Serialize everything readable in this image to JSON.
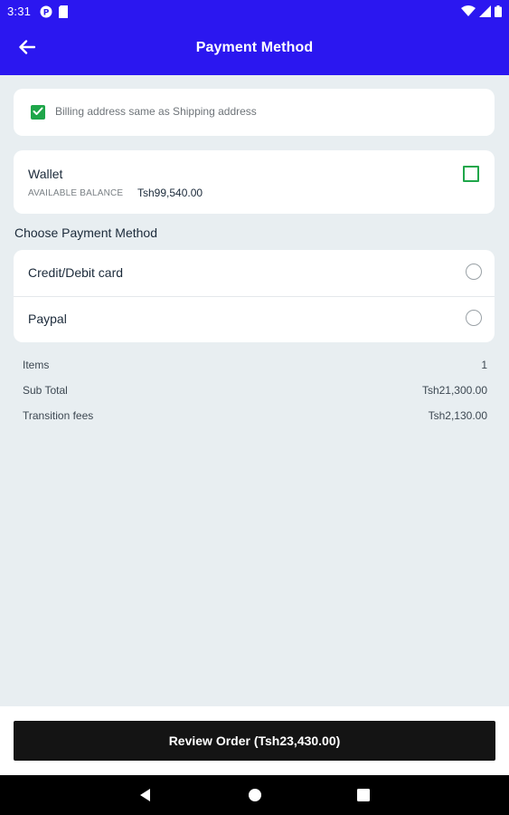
{
  "status_bar": {
    "time": "3:31",
    "icons": [
      "p-badge-icon",
      "sd-card-icon",
      "wifi-icon",
      "signal-icon",
      "battery-icon"
    ]
  },
  "app_bar": {
    "title": "Payment Method",
    "back_icon": "arrow-left-icon"
  },
  "billing": {
    "label": "Billing address same as Shipping address",
    "checked": true
  },
  "wallet": {
    "title": "Wallet",
    "balance_label": "AVAILABLE BALANCE",
    "balance_value": "Tsh99,540.00",
    "checked": false
  },
  "payment_methods": {
    "heading": "Choose Payment Method",
    "options": [
      {
        "label": "Credit/Debit card",
        "selected": false
      },
      {
        "label": "Paypal",
        "selected": false
      }
    ]
  },
  "summary": {
    "rows": [
      {
        "label": "Items",
        "value": "1"
      },
      {
        "label": "Sub Total",
        "value": "Tsh21,300.00"
      },
      {
        "label": "Transition fees",
        "value": "Tsh2,130.00"
      }
    ]
  },
  "review_button": {
    "label": "Review Order (Tsh23,430.00)"
  },
  "nav_bar": {
    "icons": [
      "back-triangle-icon",
      "home-circle-icon",
      "recents-square-icon"
    ]
  },
  "colors": {
    "app_bar": "#2B17F0",
    "background": "#E8EEF1",
    "accent_green": "#1FA64A",
    "button": "#141414"
  }
}
